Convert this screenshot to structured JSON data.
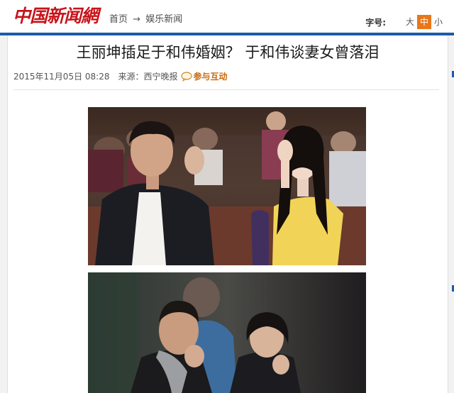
{
  "site": {
    "logo_text": "中国新闻網",
    "breadcrumb": [
      "首页",
      "→",
      "娱乐新闻"
    ]
  },
  "font_size": {
    "label": "字号:",
    "options": [
      "大",
      "中",
      "小"
    ],
    "selected": "中"
  },
  "article": {
    "title": "王丽坤插足于和伟婚姻？ 于和伟谈妻女曾落泪",
    "date": "2015年11月05日 08:28",
    "source": "来源：西宁晚报",
    "interact_label": "参与互动"
  },
  "colors": {
    "brand_red": "#c8141b",
    "rule_blue": "#1d5ba9",
    "accent_orange": "#e8761a"
  }
}
